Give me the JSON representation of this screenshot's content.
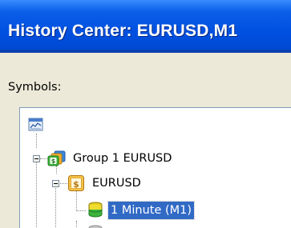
{
  "window": {
    "title": "History Center: EURUSD,M1"
  },
  "symbols_label": "Symbols:",
  "tree": {
    "root_icon": "chart-window-icon",
    "nodes": [
      {
        "label": "Group 1 EURUSD",
        "icon": "group-dollar-icon",
        "expanded": true
      },
      {
        "label": "EURUSD",
        "icon": "dollar-icon",
        "expanded": true
      },
      {
        "label": "1 Minute (M1)",
        "icon": "database-icon",
        "selected": true
      }
    ]
  },
  "colors": {
    "titlebar": "#0050e0",
    "selection": "#316ac5",
    "dialog_bg": "#ece9d8"
  }
}
